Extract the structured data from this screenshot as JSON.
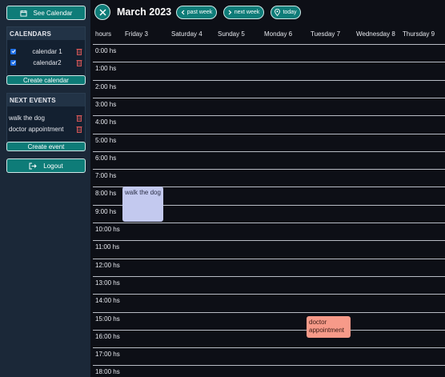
{
  "sidebar": {
    "see_calendar": "See Calendar",
    "calendars_title": "CALENDARS",
    "calendars": [
      {
        "label": "calendar 1",
        "checked": true
      },
      {
        "label": "calendar2",
        "checked": true
      }
    ],
    "create_calendar": "Create calendar",
    "next_events_title": "NEXT EVENTS",
    "events": [
      {
        "label": "walk the dog"
      },
      {
        "label": "doctor appointment"
      }
    ],
    "create_event": "Create event",
    "logout": "Logout"
  },
  "header": {
    "title": "March 2023",
    "past_week": "past week",
    "next_week": "next week",
    "today": "today"
  },
  "columns": [
    "hours",
    "Friday 3",
    "Saturday 4",
    "Sunday 5",
    "Monday 6",
    "Tuesday 7",
    "Wednesday 8",
    "Thursday 9"
  ],
  "hours": [
    "0:00 hs",
    "1:00 hs",
    "2:00 hs",
    "3:00 hs",
    "4:00 hs",
    "5:00 hs",
    "6:00 hs",
    "7:00 hs",
    "8:00 hs",
    "9:00 hs",
    "10:00 hs",
    "11:00 hs",
    "12:00 hs",
    "13:00 hs",
    "14:00 hs",
    "15:00 hs",
    "16:00 hs",
    "17:00 hs",
    "18:00 hs"
  ],
  "grid_events": [
    {
      "title": "walk the dog",
      "day": "Friday 3",
      "start": "8:00",
      "end": "10:00",
      "color": "#c3c9ef"
    },
    {
      "title": "doctor appointment",
      "day": "Tuesday 7",
      "start": "15:00",
      "end": "16:00",
      "color": "#f79a89"
    }
  ],
  "colors": {
    "accent": "#0e7c78",
    "sidebar": "#1b2838",
    "background": "#0d0f16",
    "trash": "#e05a5a"
  }
}
